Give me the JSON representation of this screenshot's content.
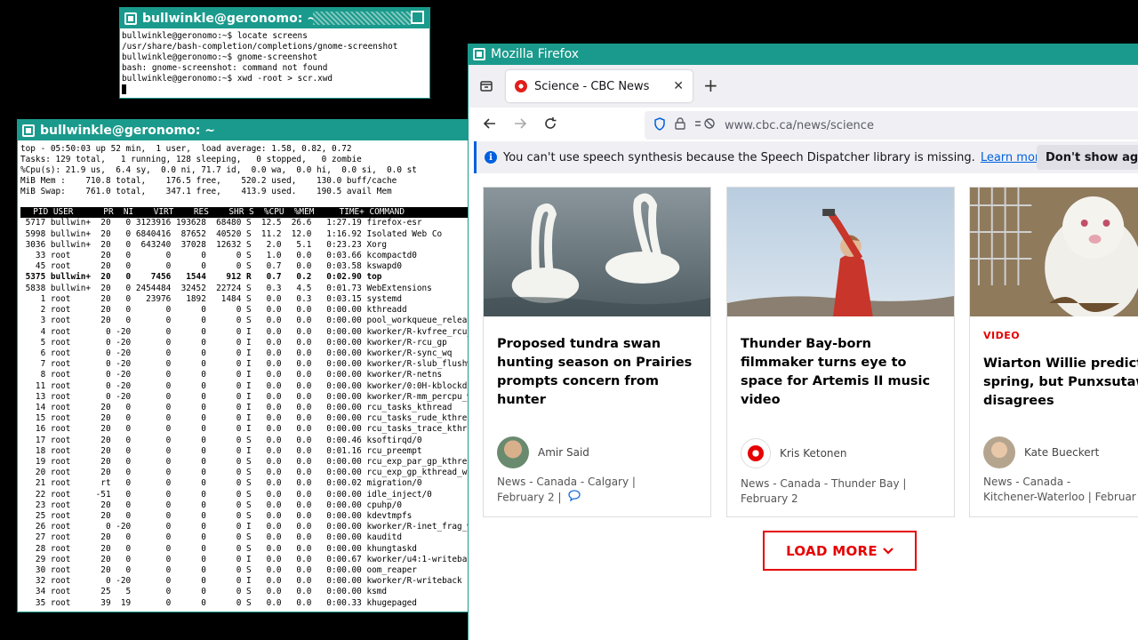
{
  "term1": {
    "title": "bullwinkle@geronomo: ~",
    "lines": [
      "bullwinkle@geronomo:~$ locate screens",
      "/usr/share/bash-completion/completions/gnome-screenshot",
      "bullwinkle@geronomo:~$ gnome-screenshot",
      "bash: gnome-screenshot: command not found",
      "bullwinkle@geronomo:~$ xwd -root > scr.xwd"
    ]
  },
  "term2": {
    "title": "bullwinkle@geronomo: ~",
    "header": [
      "top - 05:50:03 up 52 min,  1 user,  load average: 1.58, 0.82, 0.72",
      "Tasks: 129 total,   1 running, 128 sleeping,   0 stopped,   0 zombie",
      "%Cpu(s): 21.9 us,  6.4 sy,  0.0 ni, 71.7 id,  0.0 wa,  0.0 hi,  0.0 si,  0.0 st",
      "MiB Mem :    710.8 total,    176.5 free,    520.2 used,    130.0 buff/cache",
      "MiB Swap:    761.0 total,    347.1 free,    413.9 used.    190.5 avail Mem"
    ],
    "column_header": "  PID USER      PR  NI    VIRT    RES    SHR S  %CPU  %MEM     TIME+ COMMAND",
    "rows": [
      " 5717 bullwin+  20   0 3123916 193628  68480 S  12.5  26.6   1:27.19 firefox-esr",
      " 5998 bullwin+  20   0 6840416  87652  40520 S  11.2  12.0   1:16.92 Isolated Web Co",
      " 3036 bullwin+  20   0  643240  37028  12632 S   2.0   5.1   0:23.23 Xorg",
      "   33 root      20   0       0      0      0 S   1.0   0.0   0:03.66 kcompactd0",
      "   45 root      20   0       0      0      0 S   0.7   0.0   0:03.58 kswapd0",
      " 5375 bullwin+  20   0    7456   1544    912 R   0.7   0.2   0:02.90 top",
      " 5838 bullwin+  20   0 2454484  32452  22724 S   0.3   4.5   0:01.73 WebExtensions",
      "    1 root      20   0   23976   1892   1484 S   0.0   0.3   0:03.15 systemd",
      "    2 root      20   0       0      0      0 S   0.0   0.0   0:00.00 kthreadd",
      "    3 root      20   0       0      0      0 S   0.0   0.0   0:00.00 pool_workqueue_release",
      "    4 root       0 -20       0      0      0 I   0.0   0.0   0:00.00 kworker/R-kvfree_rcu_reclaim",
      "    5 root       0 -20       0      0      0 I   0.0   0.0   0:00.00 kworker/R-rcu_gp",
      "    6 root       0 -20       0      0      0 I   0.0   0.0   0:00.00 kworker/R-sync_wq",
      "    7 root       0 -20       0      0      0 I   0.0   0.0   0:00.00 kworker/R-slub_flushwq",
      "    8 root       0 -20       0      0      0 I   0.0   0.0   0:00.00 kworker/R-netns",
      "   11 root       0 -20       0      0      0 I   0.0   0.0   0:00.00 kworker/0:0H-kblockd",
      "   13 root       0 -20       0      0      0 I   0.0   0.0   0:00.00 kworker/R-mm_percpu_wq",
      "   14 root      20   0       0      0      0 I   0.0   0.0   0:00.00 rcu_tasks_kthread",
      "   15 root      20   0       0      0      0 I   0.0   0.0   0:00.00 rcu_tasks_rude_kthread",
      "   16 root      20   0       0      0      0 I   0.0   0.0   0:00.00 rcu_tasks_trace_kthread",
      "   17 root      20   0       0      0      0 S   0.0   0.0   0:00.46 ksoftirqd/0",
      "   18 root      20   0       0      0      0 I   0.0   0.0   0:01.16 rcu_preempt",
      "   19 root      20   0       0      0      0 S   0.0   0.0   0:00.00 rcu_exp_par_gp_kthread_worker/0",
      "   20 root      20   0       0      0      0 S   0.0   0.0   0:00.00 rcu_exp_gp_kthread_worker",
      "   21 root      rt   0       0      0      0 S   0.0   0.0   0:00.02 migration/0",
      "   22 root     -51   0       0      0      0 S   0.0   0.0   0:00.00 idle_inject/0",
      "   23 root      20   0       0      0      0 S   0.0   0.0   0:00.00 cpuhp/0",
      "   25 root      20   0       0      0      0 S   0.0   0.0   0:00.00 kdevtmpfs",
      "   26 root       0 -20       0      0      0 I   0.0   0.0   0:00.00 kworker/R-inet_frag_wq",
      "   27 root      20   0       0      0      0 S   0.0   0.0   0:00.00 kauditd",
      "   28 root      20   0       0      0      0 S   0.0   0.0   0:00.00 khungtaskd",
      "   29 root      20   0       0      0      0 I   0.0   0.0   0:00.67 kworker/u4:1-writeback",
      "   30 root      20   0       0      0      0 S   0.0   0.0   0:00.00 oom_reaper",
      "   32 root       0 -20       0      0      0 I   0.0   0.0   0:00.00 kworker/R-writeback",
      "   34 root      25   5       0      0      0 S   0.0   0.0   0:00.00 ksmd",
      "   35 root      39  19       0      0      0 S   0.0   0.0   0:00.33 khugepaged"
    ]
  },
  "firefox": {
    "title": "Mozilla Firefox",
    "tab_title": "Science - CBC News",
    "url": "www.cbc.ca/news/science",
    "notice": {
      "text": "You can't use speech synthesis because the Speech Dispatcher library is missing.",
      "link": "Learn more",
      "button": "Don't show ag"
    },
    "cards": [
      {
        "kicker": "",
        "headline": "Proposed tundra swan hunting season on Prairies prompts concern from hunter",
        "author": "Amir Said",
        "meta1": "News  - Canada  - Calgary |",
        "meta2": "February 2 |"
      },
      {
        "kicker": "",
        "headline": "Thunder Bay-born filmmaker turns eye to space for Artemis II music video",
        "author": "Kris Ketonen",
        "meta1": "News  - Canada  - Thunder Bay |",
        "meta2": "February 2"
      },
      {
        "kicker": "VIDEO",
        "headline": "Wiarton Willie predicts e spring, but Punxsutawne disagrees",
        "author": "Kate Bueckert",
        "meta1": "News  - Canada  -",
        "meta2": "Kitchener-Waterloo | Februar"
      }
    ],
    "load_more": "LOAD MORE"
  }
}
